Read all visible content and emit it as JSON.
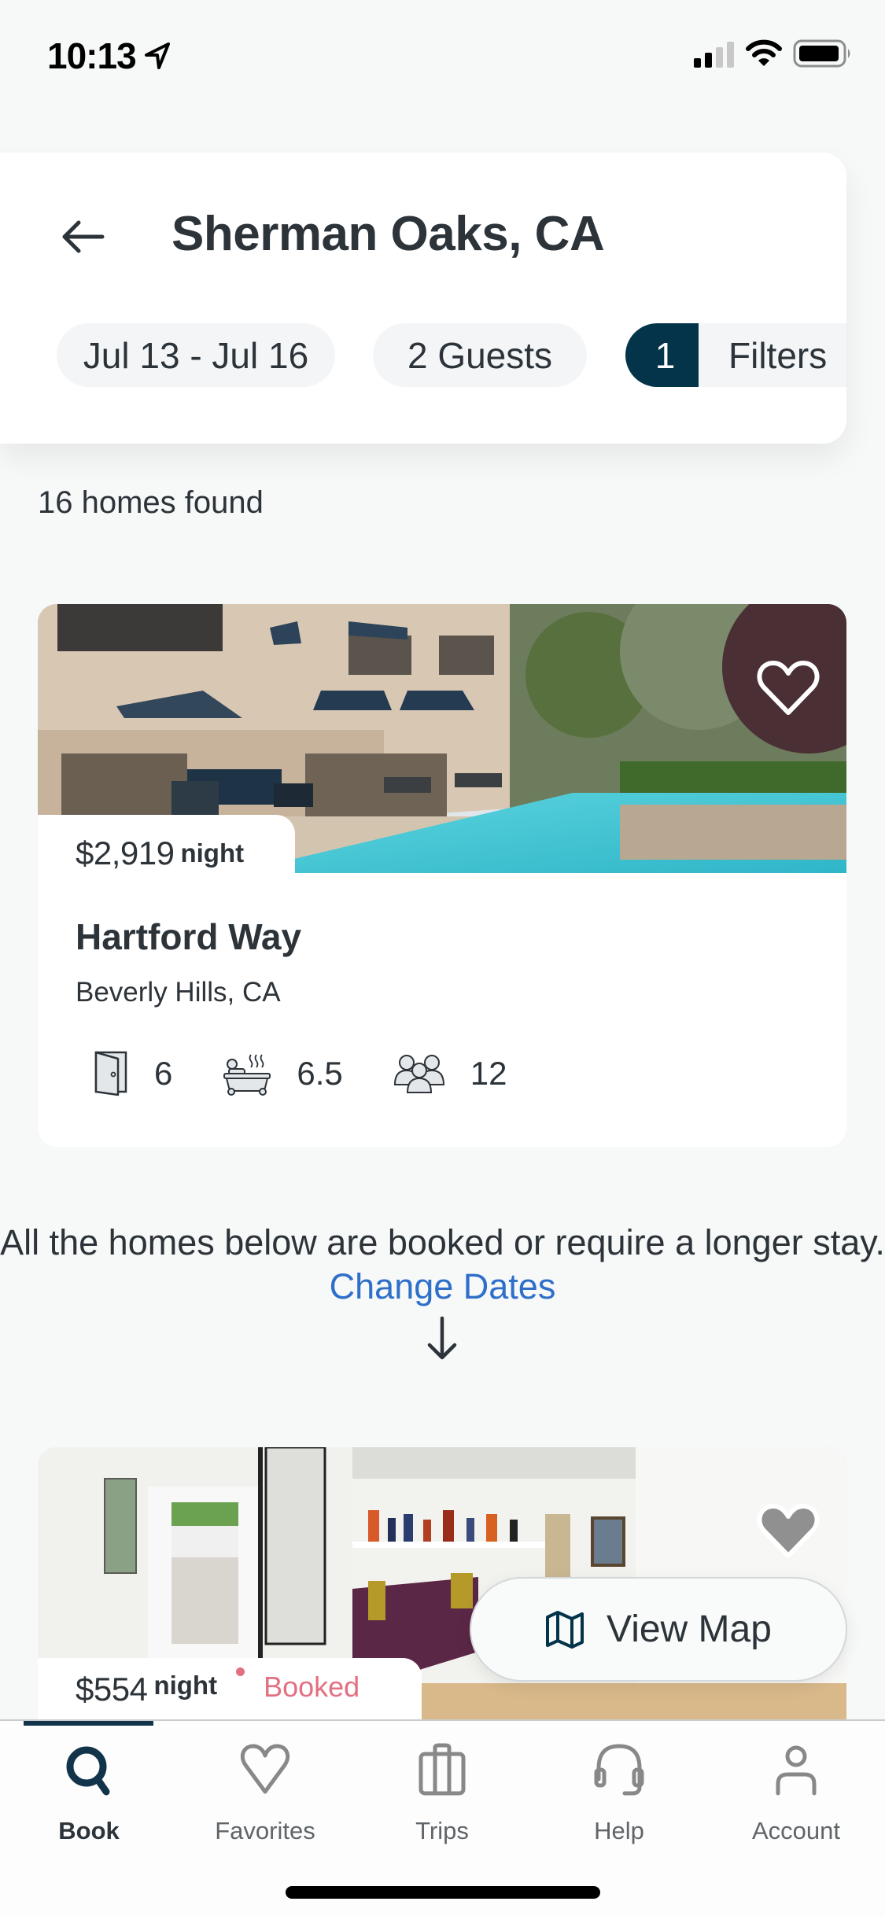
{
  "status_bar": {
    "time": "10:13",
    "location_icon": "location-arrow-icon",
    "signal_bars_active": 2,
    "signal_bars_total": 4,
    "wifi_icon": "wifi-icon",
    "battery_icon": "battery-icon"
  },
  "header": {
    "back_icon": "arrow-left-icon",
    "title": "Sherman Oaks, CA",
    "chips": {
      "dates": "Jul 13 - Jul 16",
      "guests": "2 Guests",
      "filters_count": "1",
      "filters_label": "Filters"
    }
  },
  "results": {
    "count_text": "16 homes found"
  },
  "listings": [
    {
      "price": "$2,919",
      "price_unit": "night",
      "favorite_icon": "heart-outline-icon",
      "favorited": false,
      "title": "Hartford Way",
      "location": "Beverly Hills, CA",
      "amenities": [
        {
          "icon": "door-bedroom-icon",
          "value": "6"
        },
        {
          "icon": "bathtub-icon",
          "value": "6.5"
        },
        {
          "icon": "guests-group-icon",
          "value": "12"
        }
      ]
    },
    {
      "price": "$554",
      "price_unit": "night",
      "status": "Booked",
      "favorite_icon": "heart-outline-icon",
      "favorited": false
    }
  ],
  "notice": {
    "text": "All the homes below are booked or require a longer stay.",
    "link": "Change Dates",
    "arrow_icon": "arrow-down-icon"
  },
  "view_map": {
    "icon": "map-icon",
    "label": "View Map"
  },
  "tabs": [
    {
      "label": "Book",
      "icon": "search-icon",
      "active": true
    },
    {
      "label": "Favorites",
      "icon": "heart-icon",
      "active": false
    },
    {
      "label": "Trips",
      "icon": "suitcase-icon",
      "active": false
    },
    {
      "label": "Help",
      "icon": "headset-icon",
      "active": false
    },
    {
      "label": "Account",
      "icon": "person-icon",
      "active": false
    }
  ],
  "colors": {
    "brand_navy": "#03344a",
    "text": "#2c3339",
    "link": "#2e6fca",
    "booked": "#e36f82",
    "background": "#f7f8f8"
  }
}
